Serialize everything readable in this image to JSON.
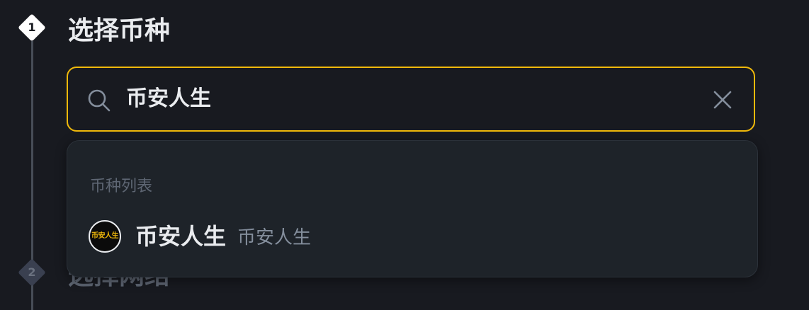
{
  "steps": [
    {
      "number": "1",
      "title": "选择币种",
      "state": "active"
    },
    {
      "number": "2",
      "title": "选择网络",
      "state": "inactive"
    }
  ],
  "search": {
    "value": "币安人生",
    "icon": "search-icon",
    "clear_icon": "close-icon",
    "accent_color": "#f0b90b"
  },
  "dropdown": {
    "header": "币种列表",
    "items": [
      {
        "logo_text": "币安人生",
        "symbol": "币安人生",
        "name": "币安人生"
      }
    ]
  },
  "colors": {
    "background": "#181a20",
    "panel": "#1e2329",
    "accent": "#f0b90b",
    "text_primary": "#eaecef",
    "text_secondary": "#848e9c",
    "text_muted": "#5e6673"
  }
}
